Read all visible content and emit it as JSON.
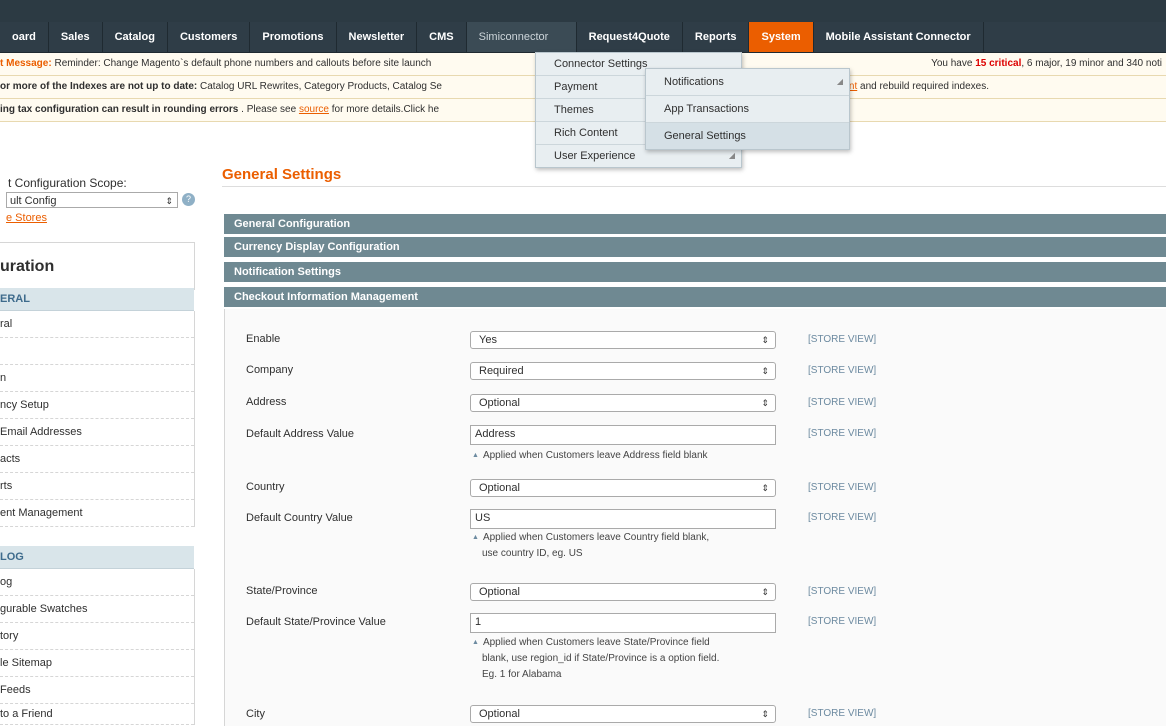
{
  "nav": {
    "items": [
      "oard",
      "Sales",
      "Catalog",
      "Customers",
      "Promotions",
      "Newsletter",
      "CMS",
      "Simiconnector",
      "Request4Quote",
      "Reports",
      "System",
      "Mobile Assistant Connector"
    ]
  },
  "messages": {
    "m1_label": "t Message:",
    "m1_text": " Reminder: Change Magento`s default phone numbers and callouts before site launch",
    "m1_right_pre": "You have ",
    "m1_critical": "15 critical",
    "m1_right_post": ", 6 major, 19 minor and 340 noti",
    "m2_bold": "or more of the Indexes are not up to date:",
    "m2_text": " Catalog URL Rewrites, Category Products, Catalog Se",
    "m2_link": "ment",
    "m2_tail": " and rebuild required indexes.",
    "m3_bold": "ing tax configuration can result in rounding errors",
    "m3_text": " . Please see ",
    "m3_link": "source",
    "m3_tail": " for more details.Click he"
  },
  "menu1": [
    "Connector Settings",
    "Payment",
    "Themes",
    "Rich Content",
    "User Experience"
  ],
  "menu2": [
    "Notifications",
    "App Transactions",
    "General Settings"
  ],
  "sidebar": {
    "scope_label": "t Configuration Scope:",
    "scope_value": "ult Config",
    "manage_link": "e Stores",
    "title": "uration",
    "section_general": "ERAL",
    "general_items": [
      "ral",
      "",
      "n",
      "ncy Setup",
      "Email Addresses",
      "acts",
      "rts",
      "ent Management"
    ],
    "section_catalog": "LOG",
    "catalog_items": [
      "og",
      "gurable Swatches",
      "tory",
      "le Sitemap",
      "Feeds",
      "to a Friend"
    ]
  },
  "main": {
    "title": "General Settings",
    "sections": [
      "General Configuration",
      "Currency Display Configuration",
      "Notification Settings",
      "Checkout Information Management"
    ],
    "store_view": "[STORE VIEW]",
    "rows": [
      {
        "label": "Enable",
        "value": "Yes",
        "type": "select"
      },
      {
        "label": "Company",
        "value": "Required",
        "type": "select"
      },
      {
        "label": "Address",
        "value": "Optional",
        "type": "select"
      },
      {
        "label": "Default Address Value",
        "value": "Address",
        "type": "input"
      },
      {
        "label": "Country",
        "value": "Optional",
        "type": "select"
      },
      {
        "label": "Default Country Value",
        "value": "US",
        "type": "input"
      },
      {
        "label": "State/Province",
        "value": "Optional",
        "type": "select"
      },
      {
        "label": "Default State/Province Value",
        "value": "1",
        "type": "input"
      },
      {
        "label": "City",
        "value": "Optional",
        "type": "select"
      }
    ],
    "notes": {
      "address": "Applied when Customers leave Address field blank",
      "country_1": "Applied when Customers leave Country field blank,",
      "country_2": "use country ID, eg. US",
      "state_1": "Applied when Customers leave State/Province field",
      "state_2": "blank, use region_id if State/Province is a option field.",
      "state_3": "Eg. 1 for Alabama"
    }
  },
  "colors": {
    "accent": "#eb5e00",
    "nav_bg": "#2f3d47",
    "section_bg": "#6f8992"
  }
}
